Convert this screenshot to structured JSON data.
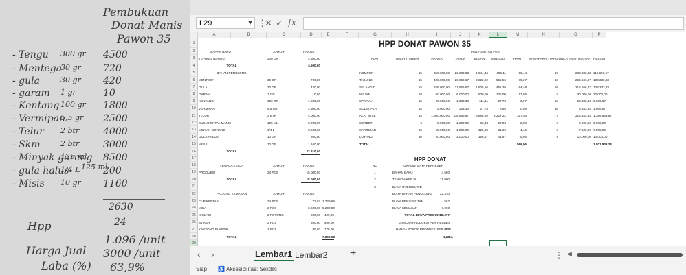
{
  "paper": {
    "title_lines": [
      "Pembukuan",
      "Donat Manis",
      "Pawon 35"
    ],
    "items": [
      {
        "name": "- Tengu",
        "qty": "300 gr",
        "price": "4500"
      },
      {
        "name": "- Mentega",
        "qty": "30 gr",
        "price": "720"
      },
      {
        "name": "- gula",
        "qty": "30 gr",
        "price": "420"
      },
      {
        "name": "- garam",
        "qty": "1 gr",
        "price": "10"
      },
      {
        "name": "- Kentang",
        "qty": "100 gr",
        "price": "1800"
      },
      {
        "name": "- Vermipan",
        "qty": "5,5 gr",
        "price": "2500"
      },
      {
        "name": "- Telur",
        "qty": "2 btr",
        "price": "4000"
      },
      {
        "name": "- Skm",
        "qty": "2 btr",
        "price": "3000"
      },
      {
        "name": "- Minyak goreng",
        "qty": "125 ml",
        "price": "8500"
      },
      {
        "name": "- gula halus",
        "qty": "1/4 L",
        "price": "200"
      },
      {
        "name": "- Misis",
        "qty": "10 gr",
        "price": "1160"
      }
    ],
    "note_skm": "125 ml",
    "total": "2630",
    "count": "24",
    "hpp_label": "Hpp",
    "hpp_value": "1.096 /unit",
    "harga_label": "Harga Jual",
    "harga_value": "3000 /unit",
    "laba_label": "Laba (%)",
    "laba_value": "63,9%"
  },
  "excel": {
    "name_box": "L29",
    "formula_icons": [
      "✕",
      "✓",
      "fx"
    ],
    "columns": [
      "A",
      "B",
      "C",
      "D",
      "E",
      "F",
      "G",
      "H",
      "I",
      "J",
      "K",
      "L",
      "M",
      "N",
      "O",
      "P"
    ],
    "rows": [
      "1",
      "2",
      "3",
      "4",
      "5",
      "6",
      "7",
      "8",
      "9",
      "10",
      "11",
      "12",
      "13",
      "14",
      "15",
      "16",
      "17",
      "18",
      "19",
      "20",
      "21",
      "22",
      "23",
      "24",
      "25",
      "26",
      "27",
      "28",
      "29"
    ],
    "title": "HPP DONAT PAWON 35",
    "left_table": {
      "headers": [
        "BAHAN BAKU",
        "JUMLAH",
        "HARGA"
      ],
      "tepung": [
        "TEPUNG TERIGU",
        "300 GR",
        "4.500,00"
      ],
      "total1": [
        "TOTAL",
        "4.500,00"
      ],
      "penolong_header": "BAHAN PENOLONG",
      "penolong": [
        [
          "MENTEGA",
          "30 GR",
          "720,00"
        ],
        [
          "GULA",
          "30 GR",
          "420,00"
        ],
        [
          "GARAM",
          "1 GR",
          "10,00"
        ],
        [
          "KENTANG",
          "100 GR",
          "1.800,00"
        ],
        [
          "VERMIPAN",
          "5,5 GR",
          "2.500,00"
        ],
        [
          "TELUR",
          "2 BTR",
          "4.000,00"
        ],
        [
          "SUSU KENTAL MANIS",
          "125 ML",
          "3.000,00"
        ],
        [
          "MINYAK GORENG",
          "1/4 L",
          "8.500,00"
        ],
        [
          "GULA HALUS",
          "10 GR",
          "200,00"
        ],
        [
          "MISIS",
          "10 GR",
          "1.160,00"
        ]
      ],
      "total2": [
        "TOTAL",
        "22.310,00"
      ],
      "tk_headers": [
        "TENAGA KERJA",
        "JUMLAH",
        "HARGA"
      ],
      "tk_row": [
        "PRODUKSI",
        "24 PCS",
        "15.000,00"
      ],
      "total3": [
        "TOTAL",
        "15.000,00"
      ],
      "pk_headers": [
        "PACKING KEMASAN",
        "JUMLAH",
        "HARGA"
      ],
      "pk_rows": [
        [
          "CUP KERTAS",
          "24 PCS",
          "72,07",
          "1.729,68"
        ],
        [
          "MIKA",
          "2 PCS",
          "2.600,00",
          "5.200,00"
        ],
        [
          "ISOLASI",
          "2 POTONG",
          "200,00",
          "400,00"
        ],
        [
          "STIKER",
          "2 PCS",
          "200,00",
          "400,00"
        ],
        [
          "KANTONG PLASTIK",
          "2 PCS",
          "85,00",
          "170,00"
        ]
      ],
      "total4": [
        "TOTAL",
        "7.899,68"
      ]
    },
    "right_table": {
      "penyusutan_header": "PENYUSUTAN PER",
      "headers": [
        "ALAT",
        "UMUR (TAHUN)",
        "HARGA",
        "TAHUN",
        "BULAN",
        "MINGGU",
        "HARI",
        "MASA PAKAI (TAHUN)",
        "NILAI PENYUSUTAN",
        "RESIDU"
      ],
      "rows": [
        [
          "KOMPOR",
          "15",
          "350.000,00",
          "23.333,33",
          "1.944,44",
          "486,11",
          "69,44",
          "10",
          "233.333,33",
          "116.666,67"
        ],
        [
          "TABUNG",
          "15",
          "400.000,00",
          "26.666,67",
          "2.222,22",
          "555,56",
          "79,37",
          "10",
          "266.666,67",
          "133.333,33"
        ],
        [
          "SELANG D",
          "15",
          "325.000,00",
          "21.666,67",
          "1.805,56",
          "451,39",
          "64,48",
          "10",
          "216.666,67",
          "108.333,33"
        ],
        [
          "WAJAN",
          "10",
          "60.000,00",
          "6.000,00",
          "500,00",
          "125,00",
          "17,86",
          "5",
          "30.000,00",
          "30.000,00"
        ],
        [
          "SPATULA",
          "15",
          "20.000,00",
          "1.333,33",
          "111,11",
          "27,78",
          "3,97",
          "10",
          "13.333,33",
          "6.666,67"
        ],
        [
          "SOLET PLA",
          "15",
          "5.000,00",
          "333,33",
          "27,78",
          "6,94",
          "0,99",
          "10",
          "3.333,33",
          "1.666,67"
        ],
        [
          "ALAT MIXE",
          "15",
          "1.600.000,00",
          "106.666,67",
          "8.888,89",
          "2.222,22",
          "317,46",
          "2",
          "213.333,33",
          "1.386.666,67"
        ],
        [
          "SERBET",
          "5",
          "5.000,00",
          "1.000,00",
          "83,33",
          "20,83",
          "2,98",
          "2",
          "2.000,00",
          "3.000,00"
        ],
        [
          "SARINGAN",
          "10",
          "15.000,00",
          "1.500,00",
          "125,00",
          "31,25",
          "4,46",
          "5",
          "7.500,00",
          "7.500,00"
        ],
        [
          "LOYANG",
          "10",
          "20.000,00",
          "2.000,00",
          "166,67",
          "41,67",
          "5,95",
          "5",
          "10.000,00",
          "10.000,00"
        ]
      ],
      "total_row": [
        "TOTAL",
        "566,96",
        "1.801.833,33"
      ]
    },
    "hpp_table": {
      "title": "HPP DONAT",
      "headers": [
        "NO",
        "URAIAN BIAYA PERRESEP"
      ],
      "rows": [
        [
          "1",
          "BAHAN BAKU",
          "4.500"
        ],
        [
          "2",
          "TENAGA KERJA",
          "15.000"
        ],
        [
          "3",
          "BIAYA OVERHEARD",
          ""
        ],
        [
          "",
          "BIAYA BAHAN PENOLONG",
          "22.310"
        ],
        [
          "",
          "BIAYA PENYUSUTAN",
          "567"
        ],
        [
          "",
          "BIAYA KEMASAN",
          "7.900"
        ]
      ],
      "total_label": "TOTAL BIAYA PRODUKSI",
      "total_value": "50.277",
      "per_resep_label": "JUMLAH PRODUKSI PER RESEP",
      "per_resep_value": "24",
      "per_pcs_label": "HARGA POKOK PRODUKSI PER PCS",
      "per_pcs_value": "2.095",
      "laba_label": "LABA",
      "laba_value": "0,58"
    },
    "sheets": [
      "Lembar1",
      "Lembar2"
    ],
    "add_sheet": "+",
    "status_ready": "Siap",
    "status_access": "Aksesibilitas: Selidiki"
  }
}
